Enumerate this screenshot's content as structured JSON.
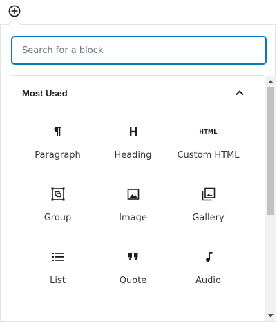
{
  "toolbar": {
    "add_icon": "plus-circle-icon"
  },
  "search": {
    "placeholder": "Search for a block",
    "value": ""
  },
  "section": {
    "title": "Most Used",
    "collapse_icon": "chevron-up-icon"
  },
  "blocks": [
    {
      "label": "Paragraph",
      "icon": "paragraph-icon"
    },
    {
      "label": "Heading",
      "icon": "heading-icon"
    },
    {
      "label": "Custom HTML",
      "icon": "html-icon",
      "icon_text": "HTML"
    },
    {
      "label": "Group",
      "icon": "group-icon"
    },
    {
      "label": "Image",
      "icon": "image-icon"
    },
    {
      "label": "Gallery",
      "icon": "gallery-icon"
    },
    {
      "label": "List",
      "icon": "list-icon"
    },
    {
      "label": "Quote",
      "icon": "quote-icon"
    },
    {
      "label": "Audio",
      "icon": "audio-icon"
    }
  ],
  "colors": {
    "accent": "#007cba",
    "border": "#e2e4e7",
    "text": "#1e1e1e"
  }
}
